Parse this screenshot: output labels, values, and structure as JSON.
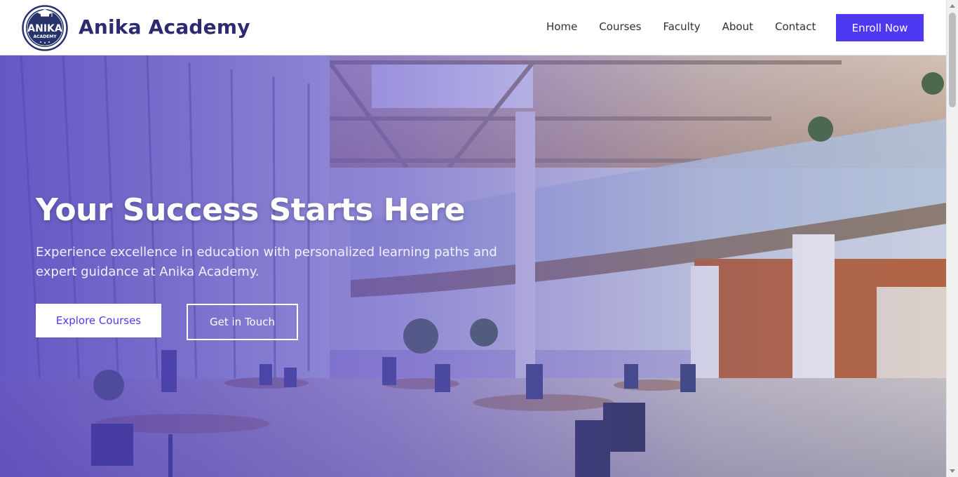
{
  "header": {
    "logo": {
      "line1": "ANIKA",
      "line2": "ACADEMY",
      "icon": "graduation-cap-icon"
    },
    "brand": "Anika Academy",
    "nav": [
      {
        "label": "Home"
      },
      {
        "label": "Courses"
      },
      {
        "label": "Faculty"
      },
      {
        "label": "About"
      },
      {
        "label": "Contact"
      }
    ],
    "enroll_label": "Enroll Now"
  },
  "hero": {
    "title": "Your Success Starts Here",
    "subtitle": "Experience excellence in education with personalized learning paths and expert guidance at Anika Academy.",
    "primary_cta": "Explore Courses",
    "secondary_cta": "Get in Touch",
    "background": "campus-atrium-photo"
  },
  "colors": {
    "brand": "#2e2a72",
    "accent": "#4f38f2",
    "overlay": "#4c3abe"
  }
}
